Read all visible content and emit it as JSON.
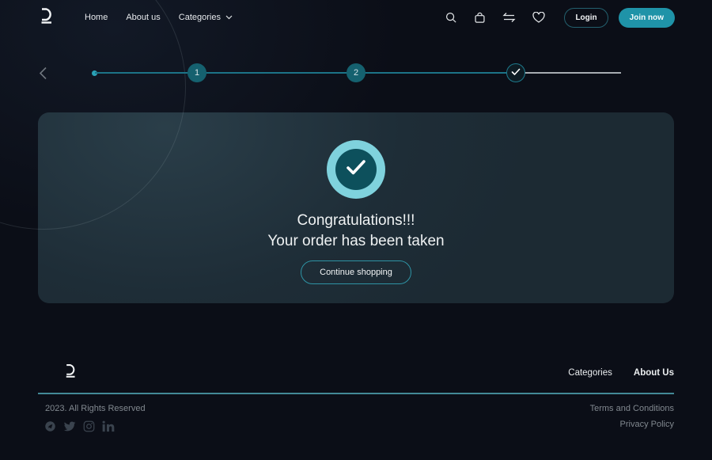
{
  "header": {
    "nav": {
      "home": "Home",
      "about": "About us",
      "categories": "Categories"
    },
    "login_label": "Login",
    "join_label": "Join now",
    "icons": [
      "search-icon",
      "shopping-bag-icon",
      "compare-arrows-icon",
      "wishlist-heart-icon"
    ]
  },
  "stepper": {
    "step1": "1",
    "step2": "2",
    "step3_icon": "check-icon"
  },
  "card": {
    "title": "Congratulations!!!",
    "subtitle": "Your order has been taken",
    "button_label": "Continue shopping"
  },
  "footer": {
    "link_categories": "Categories",
    "link_about": "About Us",
    "copyright": "2023. All Rights Reserved",
    "terms": "Terms and Conditions",
    "privacy": "Privacy Policy",
    "social_icons": [
      "telegram-icon",
      "twitter-icon",
      "instagram-icon",
      "linkedin-icon"
    ]
  },
  "colors": {
    "page_bg": "#0b0e17",
    "card_bg": "#1e2d37",
    "accent_teal": "#1f93a8",
    "step_circle_teal": "#15616f",
    "track_teal": "#1c7387",
    "badge_outer_cyan": "#7fd2dd",
    "badge_inner_teal": "#0d505c",
    "footer_divider_teal": "#4d9fae",
    "muted_text": "#81888f"
  }
}
